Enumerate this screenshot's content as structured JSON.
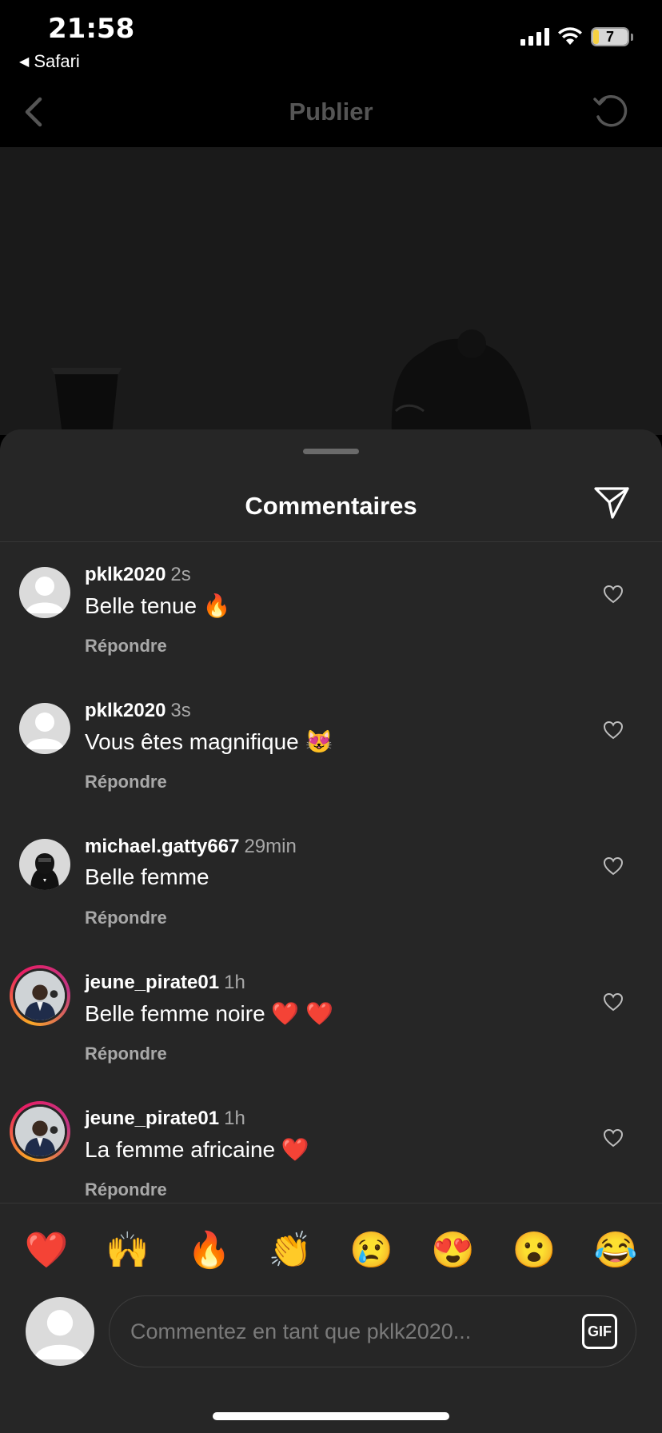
{
  "status": {
    "time": "21:58",
    "back_app": "Safari",
    "battery": "7"
  },
  "header": {
    "title": "Publier"
  },
  "sheet": {
    "title": "Commentaires"
  },
  "comments": [
    {
      "user": "pklk2020",
      "time": "2s",
      "text": "Belle tenue 🔥",
      "reply": "Répondre",
      "avatar": "default"
    },
    {
      "user": "pklk2020",
      "time": "3s",
      "text": "Vous êtes magnifique 😻",
      "reply": "Répondre",
      "avatar": "default"
    },
    {
      "user": "michael.gatty667",
      "time": "29min",
      "text": "Belle femme",
      "reply": "Répondre",
      "avatar": "photo"
    },
    {
      "user": "jeune_pirate01",
      "time": "1h",
      "text": "Belle femme noire ❤️ ❤️",
      "reply": "Répondre",
      "avatar": "story"
    },
    {
      "user": "jeune_pirate01",
      "time": "1h",
      "text": "La femme africaine ❤️",
      "reply": "Répondre",
      "avatar": "story"
    }
  ],
  "emoji_bar": [
    "❤️",
    "🙌",
    "🔥",
    "👏",
    "😢",
    "😍",
    "😮",
    "😂"
  ],
  "composer": {
    "placeholder": "Commentez en tant que pklk2020...",
    "gif_label": "GIF"
  }
}
